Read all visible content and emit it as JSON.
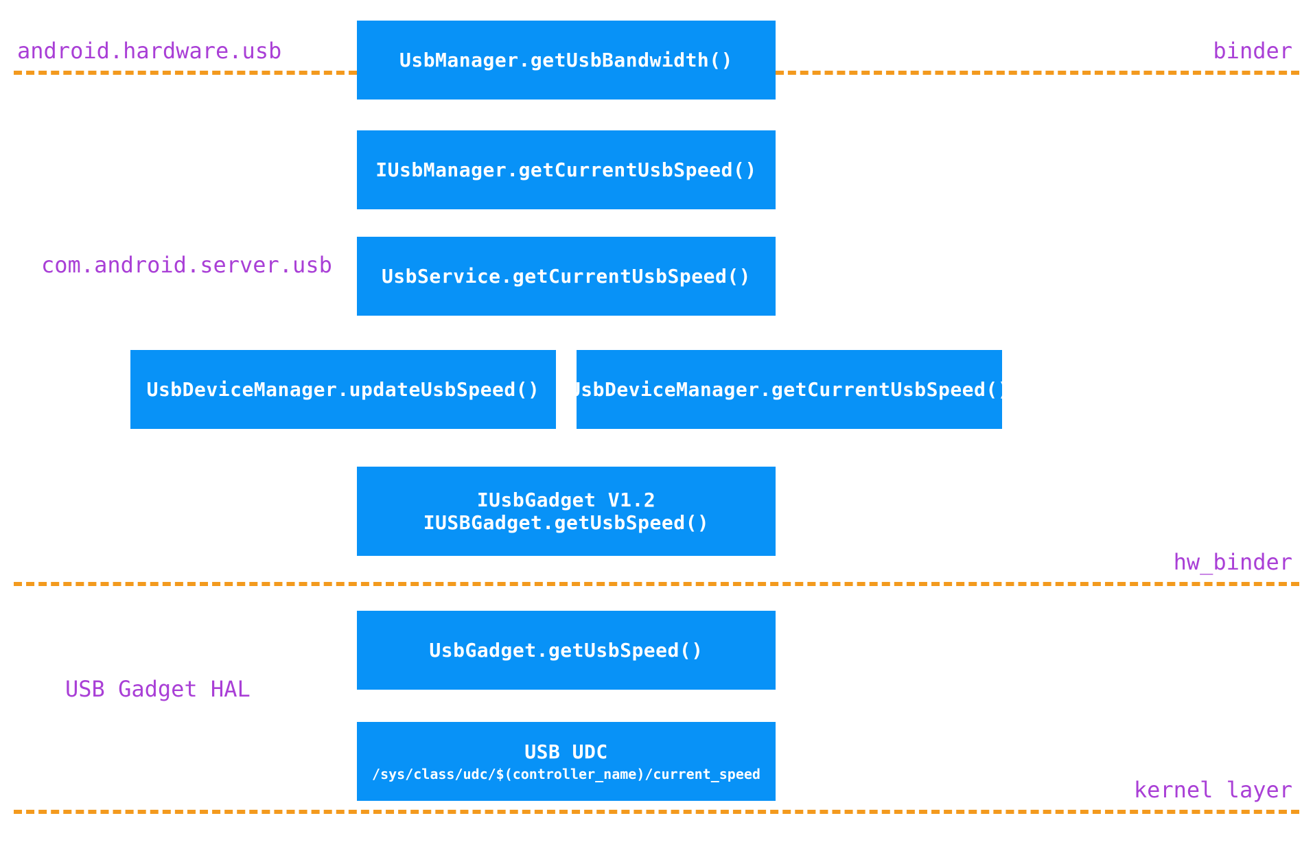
{
  "labels": {
    "android_hardware_usb": "android.hardware.usb",
    "binder": "binder",
    "com_android_server_usb": "com.android.server.usb",
    "hw_binder": "hw_binder",
    "usb_gadget_hal": "USB Gadget HAL",
    "kernel_layer": "kernel layer"
  },
  "boxes": {
    "usbmanager": "UsbManager.getUsbBandwidth()",
    "iusbmanager": "IUsbManager.getCurrentUsbSpeed()",
    "usbservice": "UsbService.getCurrentUsbSpeed()",
    "usbdevicemanager_update": "UsbDeviceManager.updateUsbSpeed()",
    "usbdevicemanager_getcurrent": "UsbDeviceManager.getCurrentUsbSpeed()",
    "iusbgadget_title": "IUsbGadget V1.2",
    "iusbgadget_sub": "IUSBGadget.getUsbSpeed()",
    "usbgadget": "UsbGadget.getUsbSpeed()",
    "usb_udc_title": "USB UDC",
    "usb_udc_sub": "/sys/class/udc/$(controller_name)/current_speed"
  },
  "colors": {
    "box_bg": "#0892f7",
    "label": "#a93fd6",
    "line": "#f39a1e"
  }
}
